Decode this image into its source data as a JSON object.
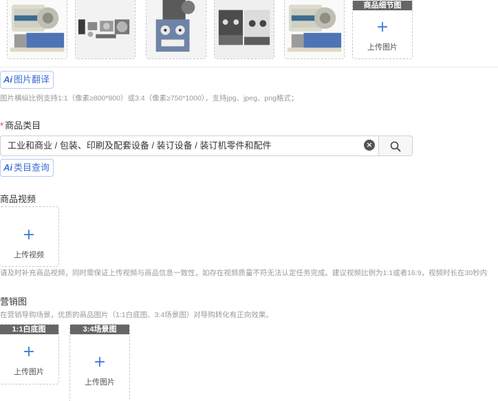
{
  "product_images": [
    {
      "name": "feeder-front"
    },
    {
      "name": "parts-kit"
    },
    {
      "name": "control-panel"
    },
    {
      "name": "dual-units"
    },
    {
      "name": "feeder-side"
    }
  ],
  "detail_upload": {
    "tag": "商品细节图",
    "label": "上传图片",
    "plus": "+"
  },
  "image_translate": {
    "ai": "Ai",
    "label": "图片翻译"
  },
  "image_hint": "图片横纵比例支持1:1（像素≥800*800）或3:4（像素≥750*1000），支持jpg、jpeg、png格式；",
  "category": {
    "required_mark": "*",
    "title": "商品类目",
    "value": "工业和商业 / 包装、印刷及配套设备 / 装订设备 / 装订机零件和配件",
    "clear": "×",
    "query_ai": "Ai",
    "query_label": "类目查询"
  },
  "video": {
    "title": "商品视频",
    "plus": "+",
    "upload_label": "上传视频",
    "hint": "请及时补充商品视频，同时需保证上传视频与商品信息一致性，如存在视频质量不符无法认定任务完成。建议视频比例为1:1或者16:9，视频时长在30秒内"
  },
  "marketing": {
    "title": "营销图",
    "hint": "在营销导购场景，优质的商品图片（1:1白底图、3:4场景图）对导购转化有正向效果。",
    "white_bg": {
      "tag": "1:1白底图",
      "plus": "+",
      "label": "上传图片"
    },
    "scene": {
      "tag": "3:4场景图",
      "plus": "+",
      "label": "上传图片"
    }
  },
  "colors": {
    "accent": "#3b6fd6",
    "required": "#e53935",
    "tag_bg": "#666666"
  }
}
